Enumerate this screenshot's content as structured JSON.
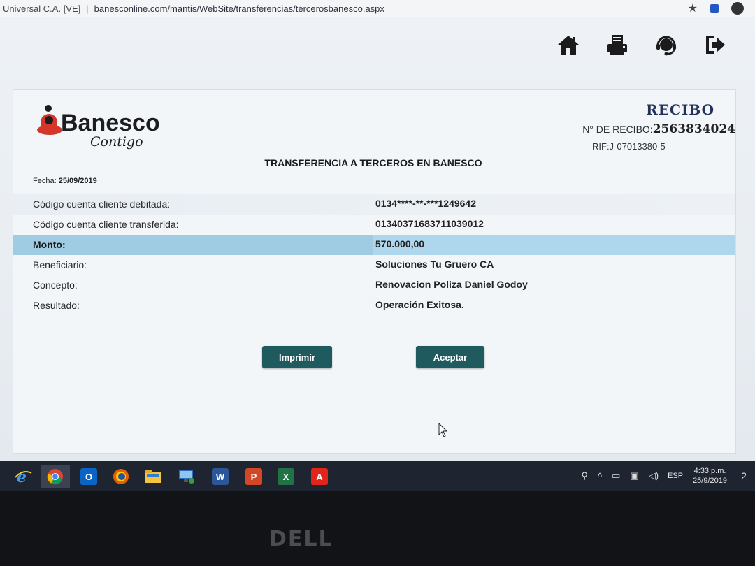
{
  "browser": {
    "tab_owner": "Universal C.A. [VE]",
    "url": "banesconline.com/mantis/WebSite/transferencias/tercerosbanesco.aspx"
  },
  "top_icons": [
    "home-icon",
    "print-icon",
    "support-icon",
    "logout-icon"
  ],
  "brand": {
    "name": "Banesco",
    "tagline": "Contigo",
    "color_red": "#d4362b",
    "color_dark": "#1d1d1f"
  },
  "receipt": {
    "heading": "RECIBO",
    "number_label": "N° DE RECIBO:",
    "number": "2563834024",
    "rif": "RIF:J-07013380-5",
    "title": "TRANSFERENCIA A TERCEROS EN BANESCO",
    "fecha_label": "Fecha:",
    "fecha": "25/09/2019",
    "rows": [
      {
        "label": "Código cuenta cliente debitada:",
        "value": "0134****-**-***1249642"
      },
      {
        "label": "Código cuenta cliente transferida:",
        "value": "01340371683711039012"
      },
      {
        "label": "Monto:",
        "value": "570.000,00"
      },
      {
        "label": "Beneficiario:",
        "value": "Soluciones Tu Gruero CA"
      },
      {
        "label": "Concepto:",
        "value": "Renovacion Poliza Daniel Godoy"
      },
      {
        "label": "Resultado:",
        "value": "Operación Exitosa."
      }
    ],
    "print_button": "Imprimir",
    "accept_button": "Aceptar",
    "button_color": "#1e5a5e",
    "highlight_color": "#9fcbe3"
  },
  "taskbar": {
    "apps": [
      "ie-icon",
      "chrome-icon",
      "outlook-icon",
      "firefox-icon",
      "file-explorer-icon",
      "remote-desktop-icon",
      "word-icon",
      "powerpoint-icon",
      "excel-icon",
      "acrobat-icon"
    ],
    "lang": "ESP",
    "time": "4:33 p.m.",
    "date": "25/9/2019",
    "notification_count": "2"
  },
  "bezel_brand": "DELL"
}
